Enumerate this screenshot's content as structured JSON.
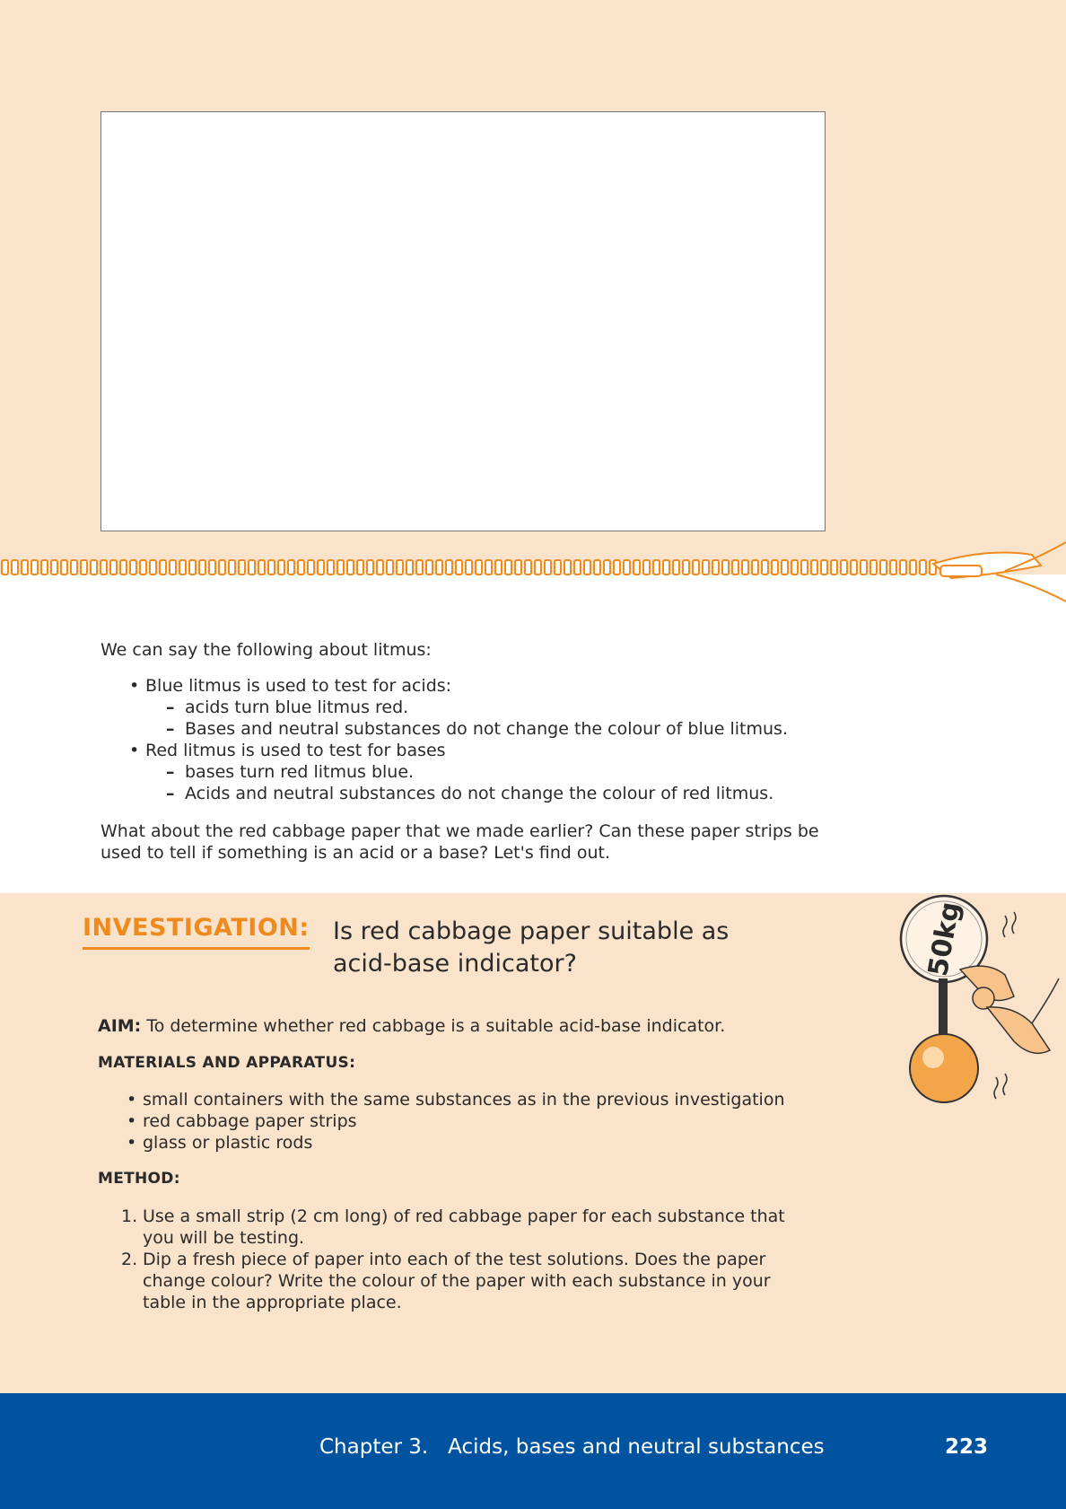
{
  "litmus": {
    "intro": "We can say the following about litmus:",
    "bullets": [
      {
        "text": "Blue litmus is used to test for acids:",
        "sub": [
          "acids turn blue litmus red.",
          "Bases and neutral substances do not change the colour of blue litmus."
        ]
      },
      {
        "text": "Red litmus is used to test for bases",
        "sub": [
          "bases turn red litmus blue.",
          "Acids and neutral substances do not change the colour of red litmus."
        ]
      }
    ],
    "closing": "What about the red cabbage paper that we made earlier? Can these paper strips be used to tell if something is an acid or a base? Let's find out."
  },
  "investigation": {
    "label": "INVESTIGATION:",
    "title_line1": "Is red cabbage paper suitable as",
    "title_line2": "acid-base indicator?",
    "aim_label": "AIM:",
    "aim_text": " To determine whether red cabbage is a suitable acid-base indicator.",
    "materials_heading": "MATERIALS AND APPARATUS:",
    "materials": [
      "small containers with the same substances as in the previous investigation",
      "red cabbage paper strips",
      "glass or plastic rods"
    ],
    "method_heading": "METHOD:",
    "method": [
      {
        "num": "1.",
        "text": "Use a small strip (2 cm long) of red cabbage paper for each substance that you will be testing."
      },
      {
        "num": "2.",
        "text": "Dip a fresh piece of paper into each of the test solutions. Does the paper change colour? Write the colour of the paper with each substance in your table in the appropriate place."
      }
    ],
    "mascot_weight_label": "50kg"
  },
  "footer": {
    "chapter": "Chapter 3.   Acids, bases and neutral substances",
    "page": "223"
  },
  "colors": {
    "peach_background": "#fae3cb",
    "accent_orange": "#ee8a1e",
    "footer_blue": "#00539f"
  }
}
